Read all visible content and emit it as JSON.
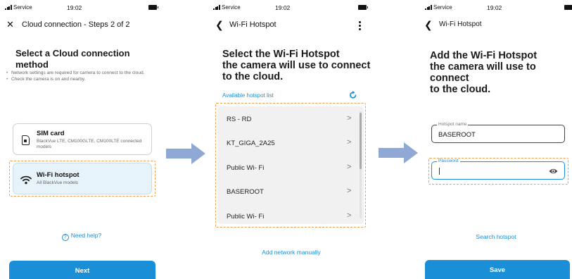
{
  "status": {
    "carrier": "Service",
    "time": "19:02"
  },
  "screen1": {
    "close_icon": "close-icon",
    "title": "Cloud connection - Steps 2 of 2",
    "heading": "Select a Cloud connection method",
    "notes": [
      "Network settings are required for camera to connect to the cloud.",
      "Check the camera is on and nearby."
    ],
    "options": [
      {
        "icon": "sim-card-icon",
        "title": "SIM card",
        "subtitle": "BlackVue LTE, CM100GLTE, CM100LTE connected models"
      },
      {
        "icon": "wifi-icon",
        "title": "Wi-Fi hotspot",
        "subtitle": "All BlackVue models"
      }
    ],
    "help_link": "Need help?",
    "next_button": "Next"
  },
  "screen2": {
    "title": "Wi-Fi Hotspot",
    "heading_lines": [
      "Select the Wi-Fi Hotspot",
      "the camera will use to connect",
      "to the cloud."
    ],
    "list_label": "Available hotspot list",
    "hotspots": [
      "RS - RD",
      "KT_GIGA_2A25",
      "Public Wi- Fi",
      "BASEROOT",
      "Public Wi- Fi"
    ],
    "add_manually": "Add network manually"
  },
  "screen3": {
    "title": "Wi-Fi Hotspot",
    "heading_lines": [
      "Add the Wi-Fi Hotspot",
      "the camera will use to connect",
      "to the cloud."
    ],
    "hotspot_name_label": "Hotspot name",
    "hotspot_name_value": "BASEROOT",
    "password_label": "Password",
    "password_value": "",
    "search_link": "Search hotspot",
    "save_button": "Save"
  },
  "colors": {
    "accent": "#1a8fd8",
    "highlight": "#f0a050",
    "arrow": "#8fa8d4",
    "selected_card": "#e6f3fb"
  }
}
